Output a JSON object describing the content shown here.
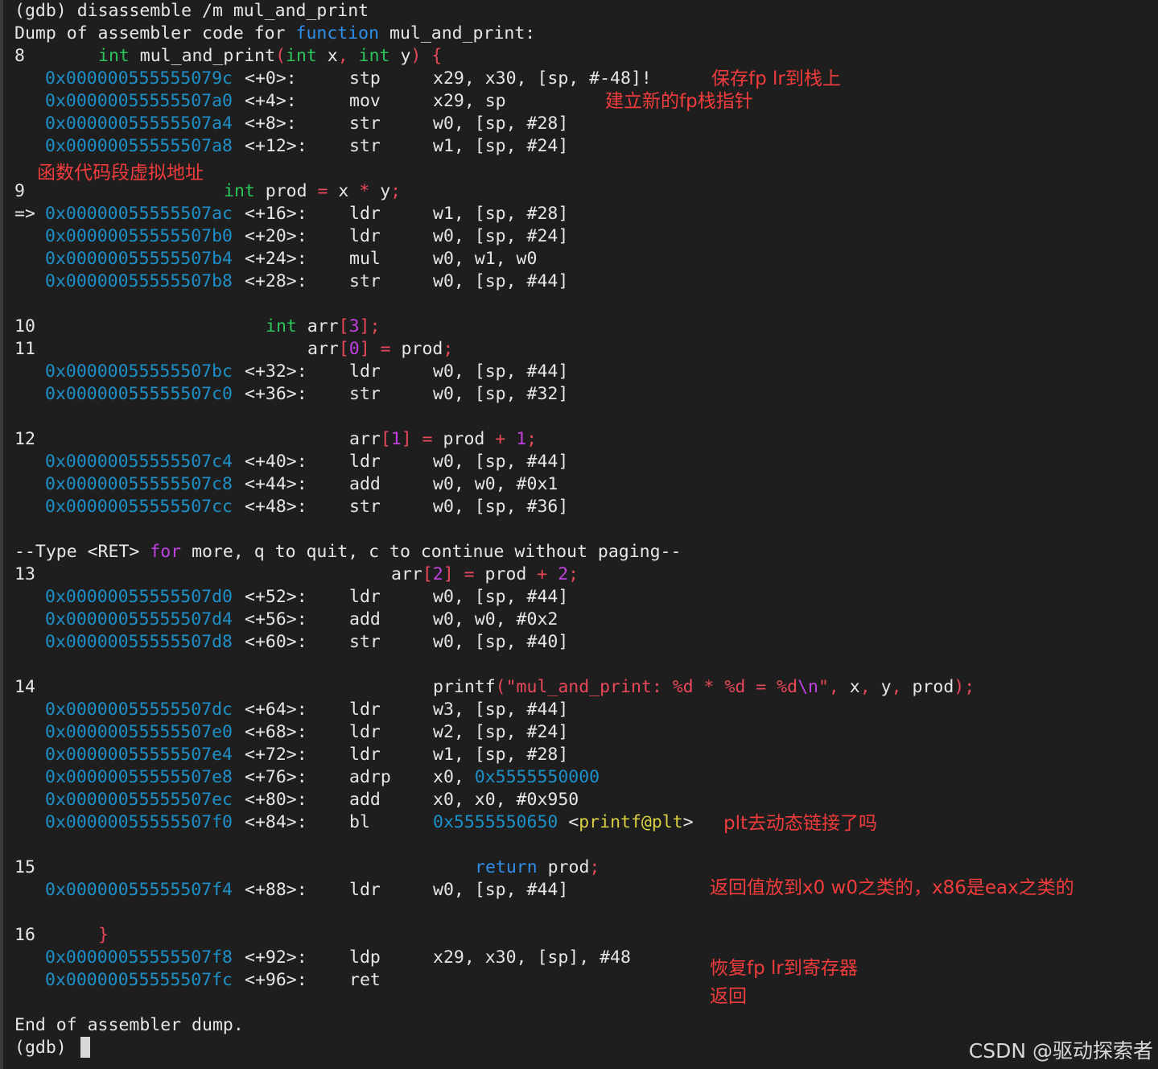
{
  "cmd": {
    "prompt": "(gdb)",
    "command": "disassemble /m mul_and_print"
  },
  "dump_header": {
    "p1": "Dump of assembler code for ",
    "kw": "function",
    "p2": " mul_and_print:"
  },
  "src8": {
    "no": "8",
    "t1": "int",
    "t2": " mul_and_print",
    "t3": "(",
    "t4": "int",
    "t5": " x",
    "t6": ",",
    "t7": " ",
    "t8": "int",
    "t9": " y",
    "t10": ")",
    "t11": " {"
  },
  "src9": {
    "no": "9",
    "t1": "int",
    "t2": " prod ",
    "t3": "=",
    "t4": " x ",
    "t5": "*",
    "t6": " y",
    "t7": ";"
  },
  "src10": {
    "no": "10",
    "t1": "int",
    "t2": " arr",
    "t3": "[",
    "t4": "3",
    "t5": "];"
  },
  "src11": {
    "no": "11",
    "t1": "arr",
    "t2": "[",
    "t3": "0",
    "t4": "]",
    "t5": " ",
    "t6": "=",
    "t7": " prod",
    "t8": ";"
  },
  "src12": {
    "no": "12",
    "t1": "arr",
    "t2": "[",
    "t3": "1",
    "t4": "]",
    "t5": " ",
    "t6": "=",
    "t7": " prod ",
    "t8": "+",
    "t9": " ",
    "t10": "1",
    "t11": ";"
  },
  "src13": {
    "no": "13",
    "t1": "arr",
    "t2": "[",
    "t3": "2",
    "t4": "]",
    "t5": " ",
    "t6": "=",
    "t7": " prod ",
    "t8": "+",
    "t9": " ",
    "t10": "2",
    "t11": ";"
  },
  "src14": {
    "no": "14",
    "t1": "printf",
    "t2": "(\"mul_and_print: %d * %d = %d",
    "t3": "\\n",
    "t4": "\"",
    "t5": ",",
    "t6": " x",
    "t7": ",",
    "t8": " y",
    "t9": ",",
    "t10": " prod",
    "t11": ");"
  },
  "src15": {
    "no": "15",
    "t1": "return",
    "t2": " prod",
    "t3": ";"
  },
  "src16": {
    "no": "16",
    "t1": "}"
  },
  "pager": {
    "p1": "--Type <RET> ",
    "kw": "for",
    "p2": " more, q to quit, c to continue without paging--"
  },
  "instr": [
    {
      "addr": "0x000000555555079c",
      "off": "<+0>:",
      "op": "stp",
      "args": "x29, x30, [sp, #-48]!"
    },
    {
      "addr": "0x00000055555507a0",
      "off": "<+4>:",
      "op": "mov",
      "args": "x29, sp"
    },
    {
      "addr": "0x00000055555507a4",
      "off": "<+8>:",
      "op": "str",
      "args": "w0, [sp, #28]"
    },
    {
      "addr": "0x00000055555507a8",
      "off": "<+12>:",
      "op": "str",
      "args": "w1, [sp, #24]"
    },
    {
      "addr": "0x00000055555507ac",
      "off": "<+16>:",
      "op": "ldr",
      "args": "w1, [sp, #28]",
      "marker": "=>"
    },
    {
      "addr": "0x00000055555507b0",
      "off": "<+20>:",
      "op": "ldr",
      "args": "w0, [sp, #24]"
    },
    {
      "addr": "0x00000055555507b4",
      "off": "<+24>:",
      "op": "mul",
      "args": "w0, w1, w0"
    },
    {
      "addr": "0x00000055555507b8",
      "off": "<+28>:",
      "op": "str",
      "args": "w0, [sp, #44]"
    },
    {
      "addr": "0x00000055555507bc",
      "off": "<+32>:",
      "op": "ldr",
      "args": "w0, [sp, #44]"
    },
    {
      "addr": "0x00000055555507c0",
      "off": "<+36>:",
      "op": "str",
      "args": "w0, [sp, #32]"
    },
    {
      "addr": "0x00000055555507c4",
      "off": "<+40>:",
      "op": "ldr",
      "args": "w0, [sp, #44]"
    },
    {
      "addr": "0x00000055555507c8",
      "off": "<+44>:",
      "op": "add",
      "args": "w0, w0, #0x1"
    },
    {
      "addr": "0x00000055555507cc",
      "off": "<+48>:",
      "op": "str",
      "args": "w0, [sp, #36]"
    },
    {
      "addr": "0x00000055555507d0",
      "off": "<+52>:",
      "op": "ldr",
      "args": "w0, [sp, #44]"
    },
    {
      "addr": "0x00000055555507d4",
      "off": "<+56>:",
      "op": "add",
      "args": "w0, w0, #0x2"
    },
    {
      "addr": "0x00000055555507d8",
      "off": "<+60>:",
      "op": "str",
      "args": "w0, [sp, #40]"
    },
    {
      "addr": "0x00000055555507dc",
      "off": "<+64>:",
      "op": "ldr",
      "args": "w3, [sp, #44]"
    },
    {
      "addr": "0x00000055555507e0",
      "off": "<+68>:",
      "op": "ldr",
      "args": "w2, [sp, #24]"
    },
    {
      "addr": "0x00000055555507e4",
      "off": "<+72>:",
      "op": "ldr",
      "args": "w1, [sp, #28]"
    },
    {
      "addr": "0x00000055555507e8",
      "off": "<+76>:",
      "op": "adrp",
      "args": "x0, ",
      "args_addr": "0x5555550000"
    },
    {
      "addr": "0x00000055555507ec",
      "off": "<+80>:",
      "op": "add",
      "args": "x0, x0, #0x950"
    },
    {
      "addr": "0x00000055555507f0",
      "off": "<+84>:",
      "op": "bl",
      "args": "",
      "args_addr": "0x5555550650",
      "sym_open": " <",
      "sym": "printf@plt",
      "sym_close": ">"
    },
    {
      "addr": "0x00000055555507f4",
      "off": "<+88>:",
      "op": "ldr",
      "args": "w0, [sp, #44]"
    },
    {
      "addr": "0x00000055555507f8",
      "off": "<+92>:",
      "op": "ldp",
      "args": "x29, x30, [sp], #48"
    },
    {
      "addr": "0x00000055555507fc",
      "off": "<+96>:",
      "op": "ret",
      "args": ""
    }
  ],
  "end": "End of assembler dump.",
  "final_prompt": "(gdb) ",
  "notes": {
    "save_fp_lr": "保存fp lr到栈上",
    "new_fp": "建立新的fp栈指针",
    "code_seg": "函数代码段虚拟地址",
    "plt": "plt去动态链接了吗",
    "retval": "返回值放到x0 w0之类的，x86是eax之类的",
    "restore": "恢复fp lr到寄存器",
    "return": "返回"
  },
  "watermark": "CSDN @驱动探索者",
  "colors": {
    "background": "#1e1e1e",
    "address": "#1e90c8",
    "keyword": "#2cc45a",
    "punct": "#e8485a",
    "number": "#c040e0",
    "note": "#f03c3c"
  }
}
